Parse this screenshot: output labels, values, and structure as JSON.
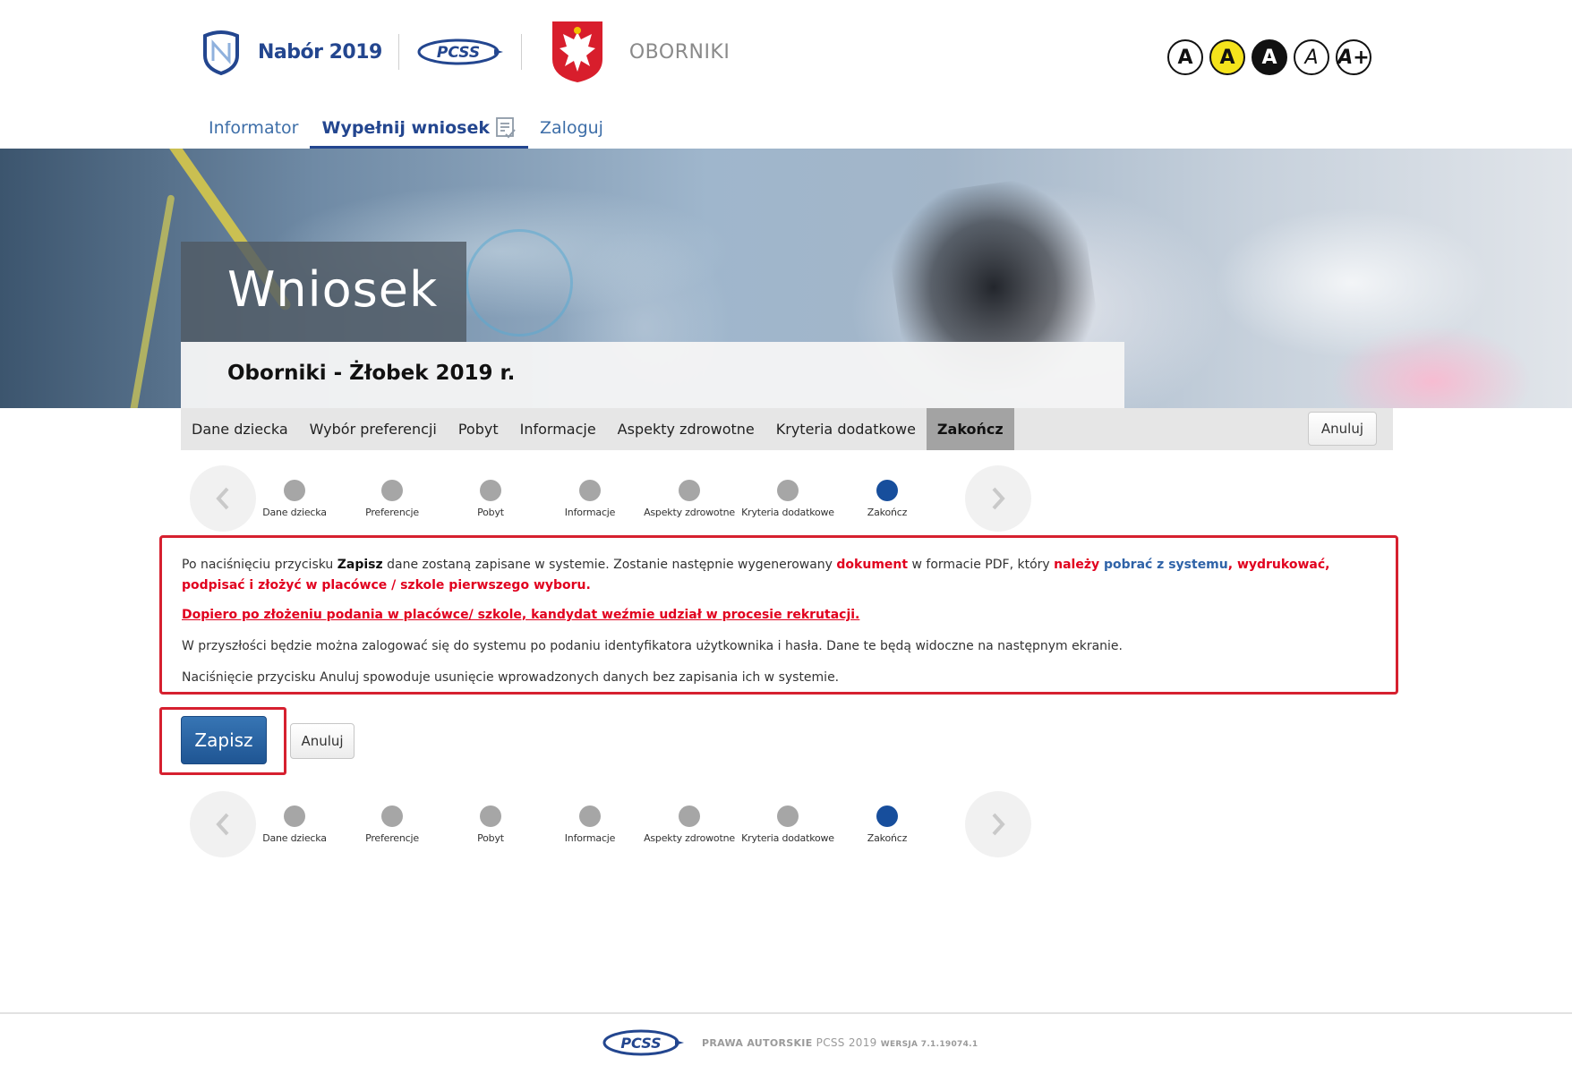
{
  "header": {
    "brand_label": "Nabór 2019",
    "partner_logo_text": "PCSS",
    "city": "OBORNIKI",
    "contrast_buttons": [
      "A",
      "A",
      "A",
      "A",
      "A+"
    ]
  },
  "topnav": {
    "items": [
      {
        "label": "Informator"
      },
      {
        "label": "Wypełnij wniosek"
      },
      {
        "label": "Zaloguj"
      }
    ]
  },
  "hero": {
    "title": "Wniosek",
    "subtitle": "Oborniki - Żłobek 2019 r."
  },
  "steptabs": {
    "items": [
      {
        "label": "Dane dziecka"
      },
      {
        "label": "Wybór preferencji"
      },
      {
        "label": "Pobyt"
      },
      {
        "label": "Informacje"
      },
      {
        "label": "Aspekty zdrowotne"
      },
      {
        "label": "Kryteria dodatkowe"
      },
      {
        "label": "Zakończ"
      }
    ],
    "cancel_label": "Anuluj"
  },
  "stepper": {
    "steps": [
      {
        "label": "Dane dziecka"
      },
      {
        "label": "Preferencje"
      },
      {
        "label": "Pobyt"
      },
      {
        "label": "Informacje"
      },
      {
        "label": "Aspekty zdrowotne"
      },
      {
        "label": "Kryteria dodatkowe"
      },
      {
        "label": "Zakończ"
      }
    ]
  },
  "info": {
    "p1_a": "Po naciśnięciu przycisku ",
    "p1_b": "Zapisz",
    "p1_c": " dane zostaną zapisane w systemie. Zostanie następnie wygenerowany ",
    "p1_d": "dokument",
    "p1_e": " w formacie PDF, który ",
    "p1_f": "należy",
    "p1_g": " pobrać z systemu",
    "p1_h": ", wydrukować, podpisać i złożyć w placówce / szkole pierwszego wyboru.",
    "p2": "Dopiero po złożeniu podania w placówce/ szkole, kandydat weźmie udział w procesie rekrutacji.",
    "p3": "W przyszłości będzie można zalogować się do systemu po podaniu identyfikatora użytkownika i hasła. Dane te będą widoczne na następnym ekranie.",
    "p4": "Naciśnięcie przycisku Anuluj spowoduje usunięcie wprowadzonych danych bez zapisania ich w systemie."
  },
  "actions": {
    "save_label": "Zapisz",
    "cancel_label": "Anuluj"
  },
  "footer": {
    "logo_text": "PCSS",
    "copyright_label": "PRAWA AUTORSKIE",
    "copyright_owner": "PCSS 2019",
    "version": "WERSJA 7.1.19074.1"
  },
  "colors": {
    "brand_blue": "#23468f",
    "accent_red": "#e1001e",
    "active_step": "#174e9c",
    "inactive_step": "#a6a6a6"
  }
}
